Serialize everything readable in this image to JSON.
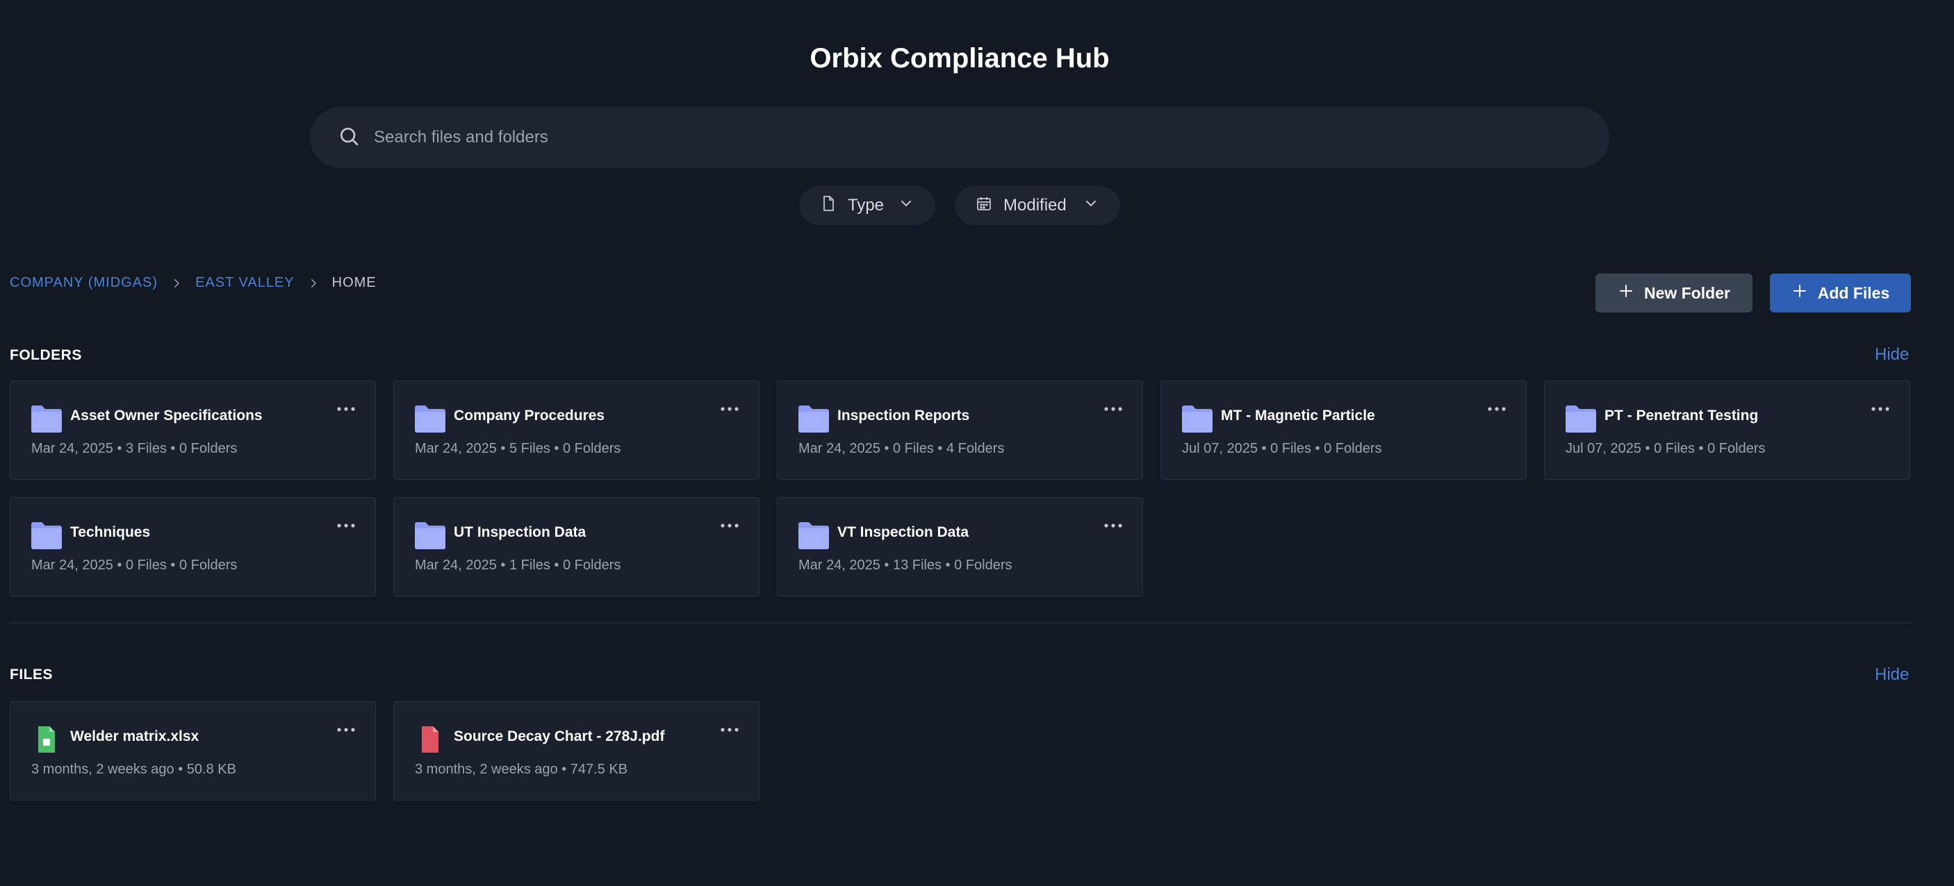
{
  "app": {
    "title": "Orbix Compliance Hub"
  },
  "search": {
    "placeholder": "Search files and folders",
    "value": ""
  },
  "filters": {
    "type_label": "Type",
    "modified_label": "Modified"
  },
  "breadcrumb": {
    "items": [
      "COMPANY (MIDGAS)",
      "EAST VALLEY",
      "HOME"
    ]
  },
  "actions": {
    "new_folder_label": "New Folder",
    "add_files_label": "Add Files"
  },
  "folders": {
    "title": "FOLDERS",
    "hide_label": "Hide",
    "items": [
      {
        "name": "Asset Owner Specifications",
        "meta": "Mar 24, 2025 • 3 Files • 0 Folders"
      },
      {
        "name": "Company Procedures",
        "meta": "Mar 24, 2025 • 5 Files • 0 Folders"
      },
      {
        "name": "Inspection Reports",
        "meta": "Mar 24, 2025 • 0 Files • 4 Folders"
      },
      {
        "name": "MT - Magnetic Particle",
        "meta": "Jul 07, 2025 • 0 Files • 0 Folders"
      },
      {
        "name": "PT - Penetrant Testing",
        "meta": "Jul 07, 2025 • 0 Files • 0 Folders"
      },
      {
        "name": "Techniques",
        "meta": "Mar 24, 2025 • 0 Files • 0 Folders"
      },
      {
        "name": "UT Inspection Data",
        "meta": "Mar 24, 2025 • 1 Files • 0 Folders"
      },
      {
        "name": "VT Inspection Data",
        "meta": "Mar 24, 2025 • 13 Files • 0 Folders"
      }
    ]
  },
  "files": {
    "title": "FILES",
    "hide_label": "Hide",
    "items": [
      {
        "name": "Welder matrix.xlsx",
        "meta": "3 months, 2 weeks ago • 50.8 KB",
        "icon": "spreadsheet-file-icon"
      },
      {
        "name": "Source Decay Chart - 278J.pdf",
        "meta": "3 months, 2 weeks ago • 747.5 KB",
        "icon": "pdf-file-icon"
      }
    ]
  },
  "colors": {
    "background": "#131923",
    "card": "#1b212c",
    "accent": "#4b82d6",
    "primary_button": "#2c5fb3",
    "secondary_button": "#3a4352",
    "folder": "#8f9cf5",
    "spreadsheet": "#4cbf6b",
    "pdf": "#e0525f"
  }
}
